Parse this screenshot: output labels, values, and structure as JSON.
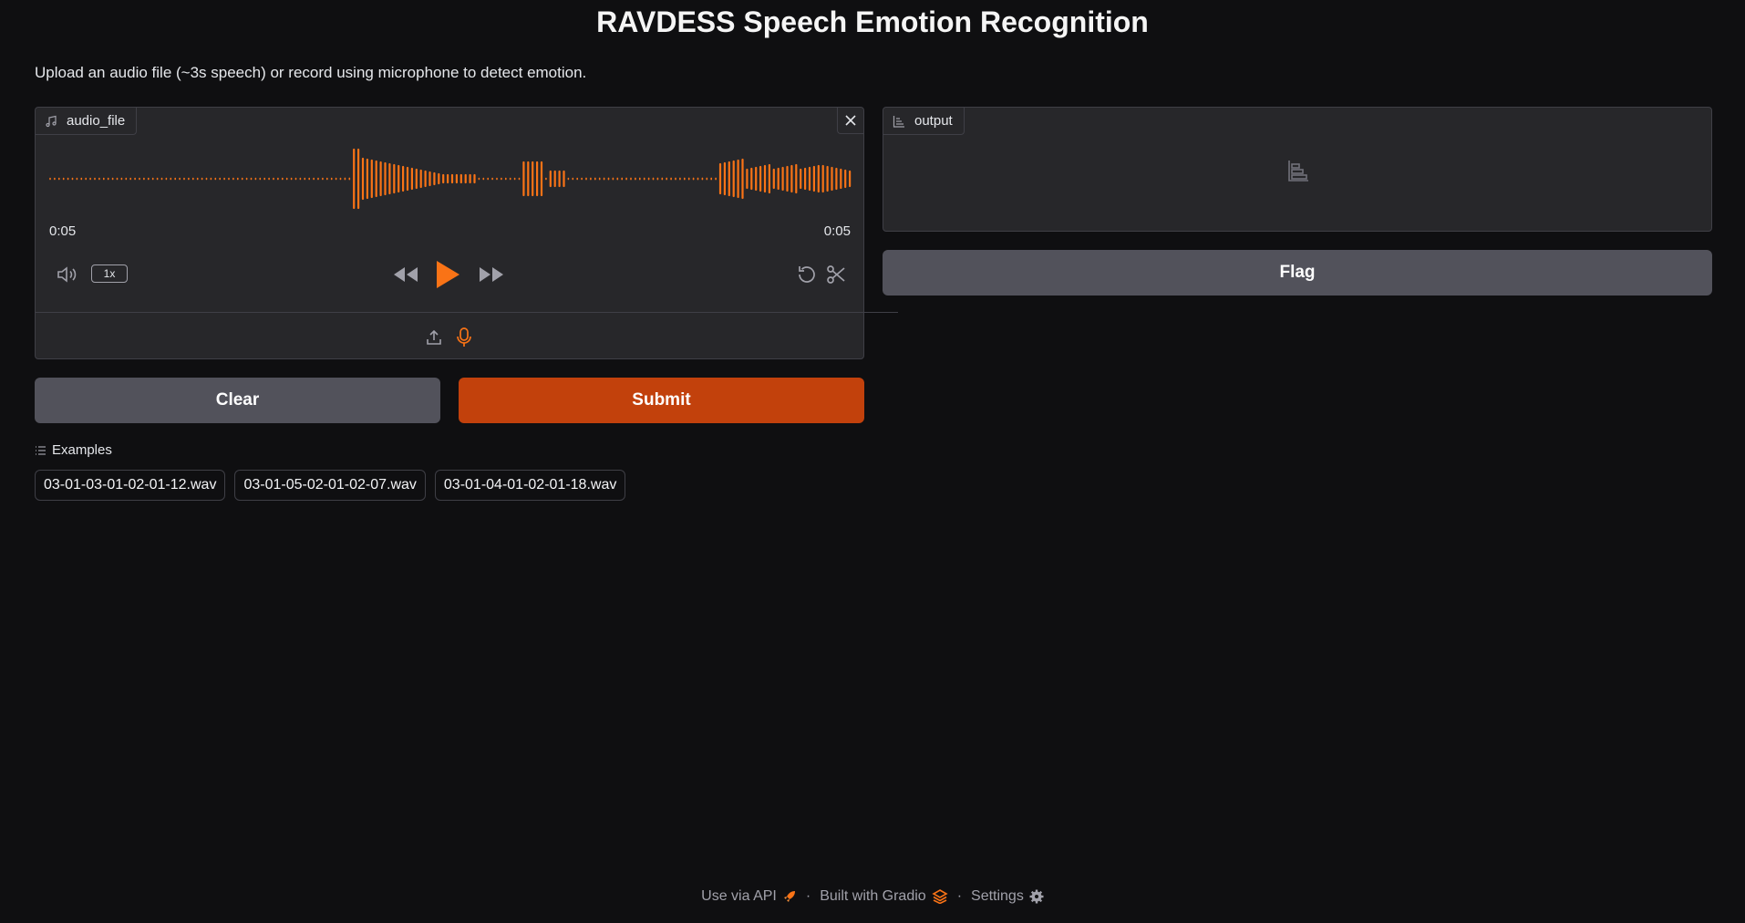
{
  "page": {
    "title": "RAVDESS Speech Emotion Recognition",
    "description": "Upload an audio file (~3s speech) or record using microphone to detect emotion."
  },
  "audio_panel": {
    "label": "audio_file",
    "label_icon": "music-note-icon",
    "time_current": "0:05",
    "time_total": "0:05",
    "playback_speed": "1x",
    "waveform_color": "#f97316",
    "icons": [
      "volume-icon",
      "rewind-icon",
      "play-icon",
      "fast-forward-icon",
      "reset-icon",
      "scissors-icon",
      "upload-icon",
      "microphone-icon",
      "close-icon"
    ]
  },
  "output_panel": {
    "label": "output",
    "label_icon": "bar-chart-icon"
  },
  "buttons": {
    "clear": "Clear",
    "submit": "Submit",
    "flag": "Flag"
  },
  "examples": {
    "heading": "Examples",
    "items": [
      "03-01-03-01-02-01-12.wav",
      "03-01-05-02-01-02-07.wav",
      "03-01-04-01-02-01-18.wav"
    ]
  },
  "footer": {
    "api": "Use via API",
    "gradio": "Built with Gradio",
    "settings": "Settings",
    "separator": "·"
  },
  "colors": {
    "accent": "#f97316",
    "submit_bg": "#c2410c",
    "button_bg": "#52525b",
    "background": "#0f0f11",
    "panel_bg": "#27272a"
  }
}
